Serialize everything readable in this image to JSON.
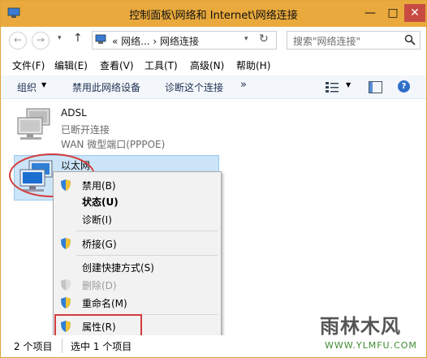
{
  "window": {
    "title": "控制面板\\网络和 Internet\\网络连接"
  },
  "address": {
    "path": "« 网络... › 网络连接",
    "search_placeholder": "搜索\"网络连接\""
  },
  "menu": [
    "文件(F)",
    "编辑(E)",
    "查看(V)",
    "工具(T)",
    "高级(N)",
    "帮助(H)"
  ],
  "commands": {
    "organize": "组织",
    "disable_device": "禁用此网络设备",
    "diagnose": "诊断这个连接",
    "more": "»"
  },
  "connections": [
    {
      "name": "ADSL",
      "status": "已断开连接",
      "device": "WAN 微型端口(PPPOE)"
    },
    {
      "name": "以太网",
      "truncated": "..."
    }
  ],
  "context_menu": {
    "disable": "禁用(B)",
    "status": "状态(U)",
    "diagnose": "诊断(I)",
    "bridge": "桥接(G)",
    "shortcut": "创建快捷方式(S)",
    "delete": "删除(D)",
    "rename": "重命名(M)",
    "properties": "属性(R)"
  },
  "statusbar": {
    "count": "2 个项目",
    "selected": "选中 1 个项目"
  },
  "watermark": {
    "text": "雨林木风",
    "url": "WWW.YLMFU.COM"
  },
  "colors": {
    "titlebar": "#e9a93c",
    "selection": "#cce4f7",
    "highlight_red": "#d23c3c"
  }
}
